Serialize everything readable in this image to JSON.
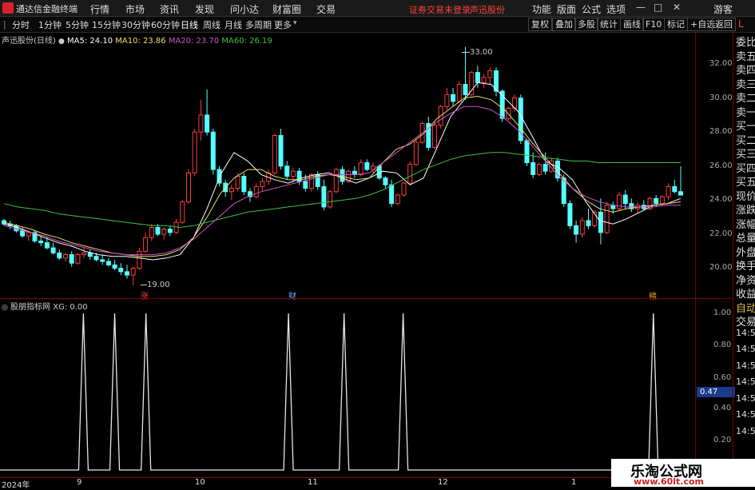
{
  "app_title": "通达信金融终端",
  "menu": [
    "行情",
    "市场",
    "资讯",
    "发现",
    "问小达",
    "财富圈",
    "交易"
  ],
  "notice": "证券交易未登录",
  "stock_name_top": "声迅股份",
  "right_menu": [
    "功能",
    "版面",
    "公式",
    "选项"
  ],
  "user": "游客",
  "periods": [
    "分时",
    "1分钟",
    "5分钟",
    "15分钟",
    "30分钟",
    "60分钟",
    "日线",
    "周线",
    "月线",
    "多周期",
    "更多"
  ],
  "active_period": "日线",
  "toolbar_right": [
    "复权",
    "叠加",
    "多股",
    "统计",
    "画线",
    "F10",
    "标记",
    "+自选",
    "返回"
  ],
  "side_l": "L",
  "main_indicator": {
    "name": "声迅股份(日线)",
    "ma5": "MA5: 24.10",
    "ma10": "MA10: 23.86",
    "ma20": "MA20: 23.70",
    "ma60": "MA60: 26.19"
  },
  "high_label": "33.00",
  "low_label": "19.00",
  "price_ticks": [
    "32.00",
    "30.00",
    "28.00",
    "26.00",
    "24.00",
    "22.00",
    "20.00"
  ],
  "markers": [
    "涨",
    "财",
    "赣"
  ],
  "sub_indicator": {
    "name": "股朋指标网",
    "xg": "XG: 0.00"
  },
  "sub_ticks": [
    "1.00",
    "0.80",
    "0.60",
    "0.47",
    "0.40",
    "0.20"
  ],
  "sub_current": "0.47",
  "side_panel": [
    "委比",
    "卖五",
    "卖四",
    "卖三",
    "卖二",
    "卖一",
    "买一",
    "买二",
    "买三",
    "买四",
    "买五",
    "现价",
    "涨跌",
    "涨幅",
    "总量",
    "外盘",
    "换手",
    "净资",
    "收益"
  ],
  "side_panel2": [
    "自动",
    "交易",
    "14:56",
    "14:56",
    "14:56",
    "14:56",
    "14:56",
    "14:56",
    "14:56"
  ],
  "date_labels": [
    "2024年",
    "9",
    "10",
    "11",
    "12",
    "1"
  ],
  "watermark": {
    "cn": "乐淘公式网",
    "url": "www.60lt.com"
  },
  "colors": {
    "up": "#ff3c3c",
    "down": "#54ffff",
    "ma5": "#ffffff",
    "ma10": "#e8e060",
    "ma20": "#d050d0",
    "ma60": "#40c040"
  },
  "chart_data": {
    "type": "candlestick",
    "ylim": [
      19,
      33
    ],
    "ohlc": [
      [
        22.8,
        22.9,
        22.5,
        22.6
      ],
      [
        22.6,
        22.8,
        22.3,
        22.5
      ],
      [
        22.5,
        22.6,
        22.1,
        22.2
      ],
      [
        22.2,
        22.4,
        21.8,
        21.9
      ],
      [
        21.9,
        22.2,
        21.6,
        22.1
      ],
      [
        22.1,
        22.2,
        21.5,
        21.6
      ],
      [
        21.6,
        21.9,
        21.3,
        21.5
      ],
      [
        21.5,
        21.8,
        21.1,
        21.2
      ],
      [
        21.2,
        21.5,
        20.8,
        20.9
      ],
      [
        20.9,
        21.1,
        20.5,
        20.6
      ],
      [
        20.6,
        20.9,
        20.4,
        20.8
      ],
      [
        20.8,
        21.0,
        20.1,
        20.3
      ],
      [
        20.3,
        20.9,
        20.2,
        20.8
      ],
      [
        20.8,
        21.2,
        20.6,
        20.9
      ],
      [
        20.9,
        21.1,
        20.5,
        20.7
      ],
      [
        20.7,
        20.9,
        20.4,
        20.5
      ],
      [
        20.5,
        20.8,
        20.2,
        20.4
      ],
      [
        20.4,
        20.6,
        20.1,
        20.2
      ],
      [
        20.2,
        20.5,
        19.9,
        20.0
      ],
      [
        20.0,
        20.3,
        19.6,
        19.8
      ],
      [
        19.8,
        20.2,
        19.4,
        19.6
      ],
      [
        19.6,
        20.1,
        19.0,
        20.0
      ],
      [
        20.0,
        21.2,
        19.9,
        21.0
      ],
      [
        21.0,
        22.1,
        20.9,
        21.8
      ],
      [
        21.8,
        22.6,
        21.6,
        22.4
      ],
      [
        22.4,
        22.6,
        21.9,
        22.0
      ],
      [
        22.0,
        22.4,
        21.7,
        22.3
      ],
      [
        22.3,
        22.5,
        21.9,
        22.1
      ],
      [
        22.1,
        22.9,
        22.0,
        22.7
      ],
      [
        22.7,
        24.0,
        22.6,
        23.9
      ],
      [
        23.9,
        25.8,
        23.8,
        25.6
      ],
      [
        25.6,
        28.2,
        25.4,
        28.0
      ],
      [
        28.0,
        29.9,
        27.5,
        29.0
      ],
      [
        29.0,
        30.5,
        27.8,
        28.0
      ],
      [
        28.0,
        28.2,
        25.5,
        25.8
      ],
      [
        25.8,
        26.0,
        24.8,
        25.0
      ],
      [
        25.0,
        25.2,
        24.2,
        24.5
      ],
      [
        24.5,
        24.9,
        24.0,
        24.7
      ],
      [
        24.7,
        25.6,
        24.5,
        25.4
      ],
      [
        25.4,
        25.6,
        24.3,
        24.5
      ],
      [
        24.5,
        24.7,
        23.9,
        24.2
      ],
      [
        24.2,
        25.0,
        24.1,
        24.8
      ],
      [
        24.8,
        25.3,
        24.5,
        25.1
      ],
      [
        25.1,
        25.8,
        24.9,
        25.6
      ],
      [
        25.6,
        27.9,
        25.5,
        27.8
      ],
      [
        27.8,
        28.2,
        25.8,
        26.0
      ],
      [
        26.0,
        26.3,
        25.2,
        25.4
      ],
      [
        25.4,
        25.9,
        25.0,
        25.7
      ],
      [
        25.7,
        25.9,
        24.9,
        25.1
      ],
      [
        25.1,
        25.5,
        24.5,
        24.7
      ],
      [
        24.7,
        25.6,
        24.5,
        25.5
      ],
      [
        25.5,
        25.7,
        24.6,
        24.8
      ],
      [
        24.8,
        25.2,
        23.4,
        23.6
      ],
      [
        23.6,
        24.6,
        23.5,
        24.5
      ],
      [
        24.5,
        25.9,
        24.4,
        25.8
      ],
      [
        25.8,
        26.0,
        24.9,
        25.1
      ],
      [
        25.1,
        25.8,
        25.0,
        25.7
      ],
      [
        25.7,
        26.0,
        25.3,
        25.5
      ],
      [
        25.5,
        26.4,
        25.4,
        26.2
      ],
      [
        26.2,
        26.4,
        25.7,
        25.8
      ],
      [
        25.8,
        26.2,
        25.6,
        26.0
      ],
      [
        26.0,
        26.1,
        25.2,
        25.3
      ],
      [
        25.3,
        25.4,
        24.7,
        24.9
      ],
      [
        24.9,
        25.2,
        23.6,
        23.8
      ],
      [
        23.8,
        24.4,
        23.7,
        24.3
      ],
      [
        24.3,
        25.1,
        24.2,
        25.0
      ],
      [
        25.0,
        26.3,
        24.9,
        26.1
      ],
      [
        26.1,
        27.6,
        26.0,
        27.4
      ],
      [
        27.4,
        28.6,
        27.3,
        28.5
      ],
      [
        28.5,
        28.9,
        26.9,
        27.1
      ],
      [
        27.1,
        28.6,
        27.0,
        28.4
      ],
      [
        28.4,
        29.6,
        28.2,
        29.5
      ],
      [
        29.5,
        30.6,
        29.3,
        30.2
      ],
      [
        30.2,
        30.6,
        29.5,
        29.8
      ],
      [
        29.8,
        31.0,
        29.7,
        30.8
      ],
      [
        30.8,
        33.0,
        29.9,
        30.2
      ],
      [
        30.2,
        31.6,
        30.1,
        31.5
      ],
      [
        31.5,
        31.9,
        30.6,
        30.9
      ],
      [
        30.9,
        31.4,
        30.6,
        31.2
      ],
      [
        31.2,
        31.8,
        30.8,
        31.6
      ],
      [
        31.6,
        31.8,
        30.1,
        30.4
      ],
      [
        30.4,
        30.5,
        28.6,
        28.8
      ],
      [
        28.8,
        29.5,
        28.7,
        29.4
      ],
      [
        29.4,
        30.2,
        29.2,
        30.0
      ],
      [
        30.0,
        30.2,
        27.3,
        27.5
      ],
      [
        27.5,
        27.6,
        26.0,
        26.2
      ],
      [
        26.2,
        26.8,
        25.3,
        25.5
      ],
      [
        25.5,
        26.2,
        25.4,
        26.1
      ],
      [
        26.1,
        26.8,
        25.5,
        25.7
      ],
      [
        25.7,
        26.5,
        25.6,
        26.3
      ],
      [
        26.3,
        26.5,
        25.1,
        25.3
      ],
      [
        25.3,
        25.5,
        23.6,
        23.8
      ],
      [
        23.8,
        24.0,
        22.3,
        22.5
      ],
      [
        22.5,
        22.8,
        21.5,
        22.0
      ],
      [
        22.0,
        23.0,
        21.8,
        22.8
      ],
      [
        22.8,
        23.5,
        22.3,
        22.5
      ],
      [
        22.5,
        23.4,
        22.4,
        23.3
      ],
      [
        23.3,
        24.1,
        21.4,
        22.1
      ],
      [
        22.1,
        23.9,
        22.0,
        23.7
      ],
      [
        23.7,
        23.9,
        23.2,
        23.5
      ],
      [
        23.5,
        24.5,
        23.4,
        24.3
      ],
      [
        24.3,
        24.6,
        23.5,
        23.8
      ],
      [
        23.8,
        24.1,
        23.3,
        23.5
      ],
      [
        23.5,
        23.9,
        23.2,
        23.7
      ],
      [
        23.7,
        24.0,
        23.4,
        23.5
      ],
      [
        23.5,
        24.2,
        23.4,
        24.1
      ],
      [
        24.1,
        24.3,
        23.6,
        23.8
      ],
      [
        23.8,
        24.3,
        23.7,
        24.2
      ],
      [
        24.2,
        25.0,
        24.0,
        24.8
      ],
      [
        24.8,
        25.2,
        24.4,
        24.5
      ],
      [
        24.5,
        26.0,
        24.3,
        24.3
      ]
    ],
    "ma_series": [
      {
        "name": "MA5",
        "values": [
          22.6,
          22.4,
          22.1,
          21.8,
          21.5,
          21.3,
          21.0,
          20.8,
          20.7,
          20.7,
          20.6,
          20.5,
          20.6,
          20.8,
          21.8,
          23.5,
          25.5,
          26.8,
          26.3,
          25.5,
          25.2,
          25.0,
          25.3,
          25.5,
          25.6,
          25.3,
          25.0,
          25.3,
          25.7,
          25.6,
          24.9,
          25.3,
          27.1,
          28.9,
          29.9,
          30.9,
          30.8,
          30.0,
          29.2,
          27.8,
          26.3,
          25.9,
          25.2,
          23.9,
          22.8,
          22.6,
          22.9,
          23.3,
          23.7,
          23.8,
          24.1
        ]
      },
      {
        "name": "MA10",
        "values": [
          22.7,
          22.5,
          22.3,
          22.0,
          21.8,
          21.5,
          21.3,
          21.1,
          20.9,
          20.8,
          20.7,
          20.7,
          20.8,
          21.1,
          21.8,
          23.0,
          24.4,
          25.3,
          25.8,
          25.8,
          25.4,
          25.2,
          25.2,
          25.4,
          25.5,
          25.4,
          25.2,
          25.3,
          26.2,
          27.0,
          27.3,
          27.9,
          28.8,
          29.4,
          30.0,
          30.1,
          29.9,
          29.3,
          28.4,
          27.4,
          26.5,
          25.6,
          24.7,
          24.0,
          23.5,
          23.3,
          23.5,
          23.6,
          23.7,
          23.8,
          23.9
        ]
      },
      {
        "name": "MA20",
        "values": [
          22.5,
          22.3,
          22.1,
          21.9,
          21.6,
          21.4,
          21.2,
          21.0,
          20.9,
          20.8,
          20.8,
          20.8,
          20.9,
          21.2,
          21.7,
          22.4,
          23.1,
          23.8,
          24.2,
          24.5,
          24.7,
          24.9,
          25.1,
          25.3,
          25.5,
          25.5,
          25.5,
          25.6,
          26.2,
          26.8,
          27.4,
          28.0,
          28.6,
          29.1,
          29.5,
          29.5,
          29.3,
          28.8,
          28.1,
          27.2,
          26.3,
          25.4,
          24.7,
          24.2,
          23.9,
          23.7,
          23.6,
          23.6,
          23.6,
          23.7,
          23.7
        ]
      },
      {
        "name": "MA60",
        "values": [
          23.8,
          23.6,
          23.5,
          23.4,
          23.2,
          23.1,
          23.0,
          22.9,
          22.8,
          22.7,
          22.6,
          22.5,
          22.5,
          22.4,
          22.5,
          22.7,
          22.9,
          23.1,
          23.3,
          23.4,
          23.5,
          23.6,
          23.7,
          23.8,
          23.9,
          24.0,
          24.1,
          24.3,
          24.6,
          25.0,
          25.4,
          25.8,
          26.1,
          26.4,
          26.6,
          26.7,
          26.8,
          26.8,
          26.7,
          26.6,
          26.5,
          26.4,
          26.3,
          26.3,
          26.2,
          26.2,
          26.2,
          26.2,
          26.2,
          26.2,
          26.2
        ]
      }
    ],
    "signal_peaks_fraction": [
      0.12,
      0.165,
      0.21,
      0.415,
      0.495,
      0.58,
      0.94
    ],
    "signal_ylim": [
      0,
      1
    ]
  }
}
